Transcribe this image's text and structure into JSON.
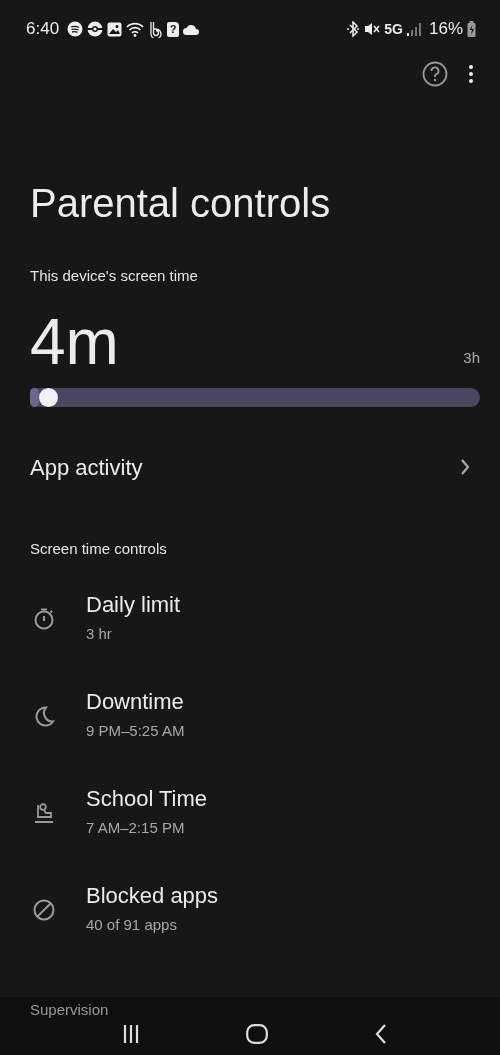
{
  "status_bar": {
    "time": "6:40",
    "sim_mark": "?",
    "network": "5G",
    "battery": "16%"
  },
  "title": "Parental controls",
  "screen_time": {
    "heading": "This device's screen time",
    "used": "4m",
    "limit": "3h",
    "level": 0.02
  },
  "app_activity": {
    "label": "App activity"
  },
  "controls": {
    "heading": "Screen time controls",
    "items": [
      {
        "kind": "timer",
        "title": "Daily limit",
        "subtitle": "3 hr"
      },
      {
        "kind": "moon",
        "title": "Downtime",
        "subtitle": "9 PM–5:25 AM"
      },
      {
        "kind": "school",
        "title": "School Time",
        "subtitle": "7 AM–2:15 PM"
      },
      {
        "kind": "blocked",
        "title": "Blocked apps",
        "subtitle": "40 of 91 apps"
      }
    ]
  },
  "next_section": "Supervision"
}
